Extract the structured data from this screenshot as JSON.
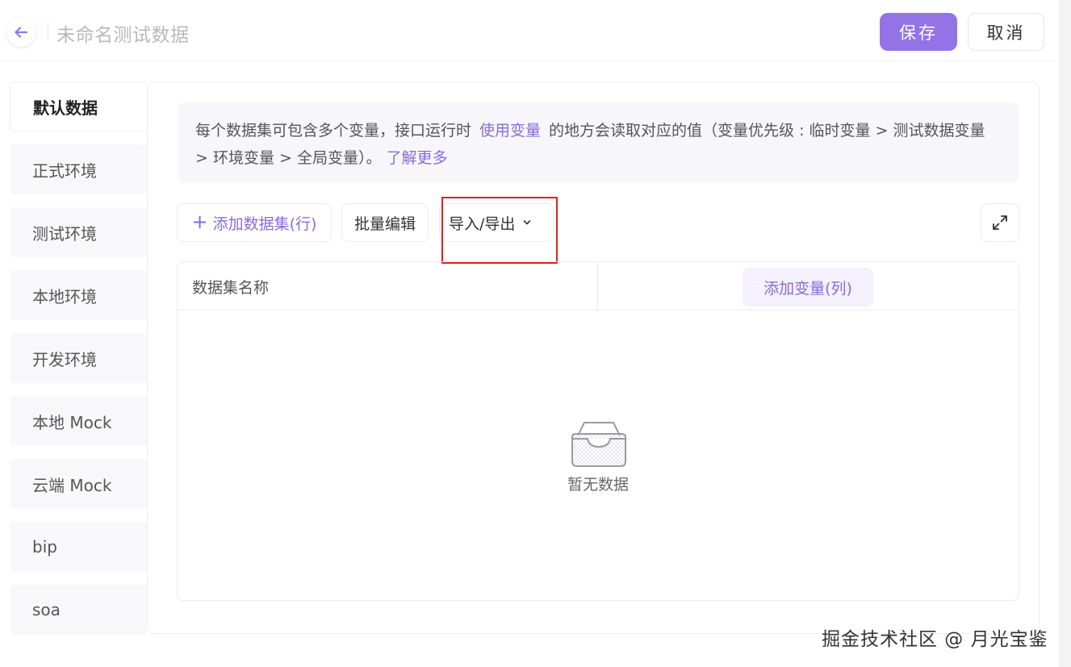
{
  "header": {
    "title": "未命名测试数据",
    "save_label": "保存",
    "cancel_label": "取消"
  },
  "sidebar": {
    "items": [
      {
        "label": "默认数据",
        "active": true
      },
      {
        "label": "正式环境"
      },
      {
        "label": "测试环境"
      },
      {
        "label": "本地环境"
      },
      {
        "label": "开发环境"
      },
      {
        "label": "本地 Mock"
      },
      {
        "label": "云端 Mock"
      },
      {
        "label": "bip"
      },
      {
        "label": "soa"
      }
    ]
  },
  "info": {
    "text_part1": "每个数据集可包含多个变量，接口运行时",
    "link_use_var": "使用变量",
    "text_part2": "的地方会读取对应的值（变量优先级 : 临时变量 > 测试数据变量 > 环境变量 > 全局变量）。",
    "link_learn_more": "了解更多"
  },
  "toolbar": {
    "add_dataset_label": "添加数据集(行)",
    "bulk_edit_label": "批量编辑",
    "import_export_label": "导入/导出"
  },
  "table": {
    "col_name_header": "数据集名称",
    "add_variable_label": "添加变量(列)",
    "empty_text": "暂无数据"
  },
  "watermark": "掘金技术社区 @ 月光宝鉴",
  "colors": {
    "accent": "#9373e6",
    "link": "#8a6bd8",
    "highlight": "#e02020"
  }
}
